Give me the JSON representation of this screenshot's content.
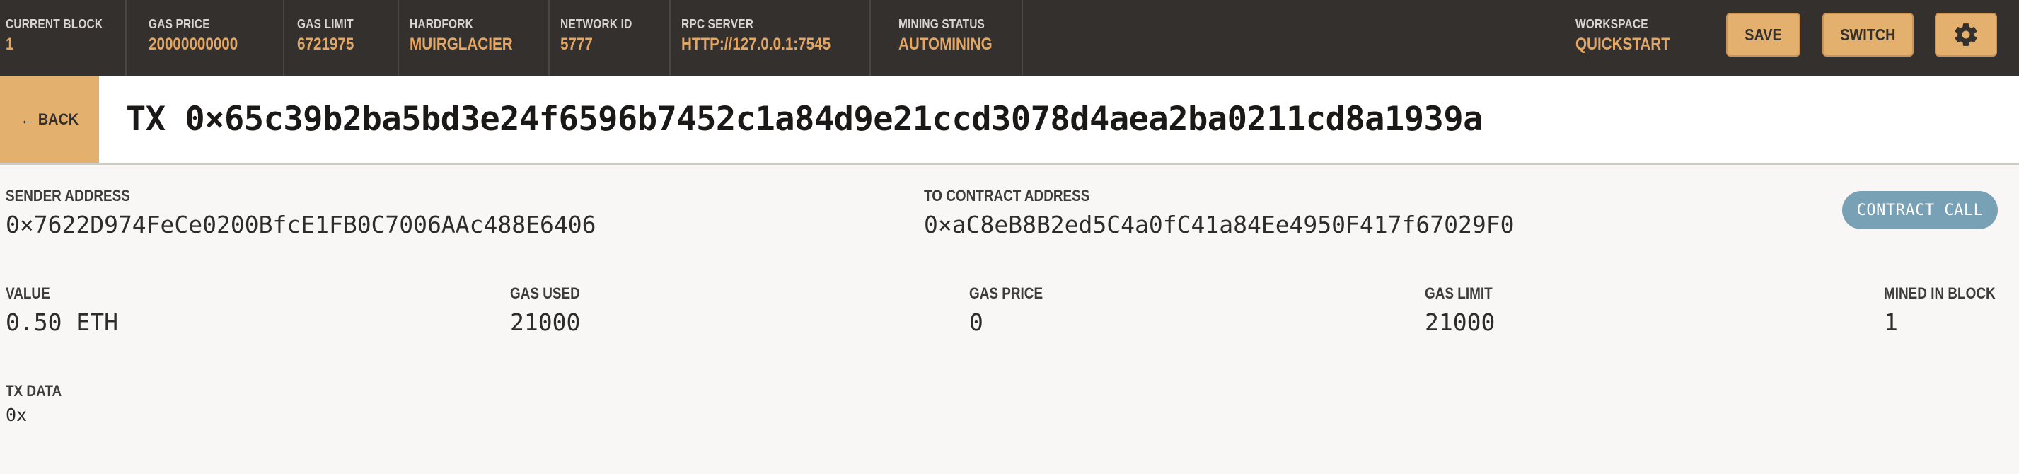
{
  "topbar": {
    "stats": [
      {
        "label": "CURRENT BLOCK",
        "value": "1"
      },
      {
        "label": "GAS PRICE",
        "value": "20000000000"
      },
      {
        "label": "GAS LIMIT",
        "value": "6721975"
      },
      {
        "label": "HARDFORK",
        "value": "MUIRGLACIER"
      },
      {
        "label": "NETWORK ID",
        "value": "5777"
      },
      {
        "label": "RPC SERVER",
        "value": "HTTP://127.0.0.1:7545"
      },
      {
        "label": "MINING STATUS",
        "value": "AUTOMINING"
      }
    ],
    "workspace": {
      "label": "WORKSPACE",
      "value": "QUICKSTART"
    },
    "save_label": "SAVE",
    "switch_label": "SWITCH",
    "settings_icon": "gear-icon"
  },
  "titlebar": {
    "back_label": "← BACK",
    "title": "TX 0×65c39b2ba5bd3e24f6596b7452c1a84d9e21ccd3078d4aea2ba0211cd8a1939a"
  },
  "tx": {
    "sender": {
      "label": "SENDER ADDRESS",
      "value": "0×7622D974FeCe0200BfcE1FB0C7006AAc488E6406"
    },
    "to": {
      "label": "TO CONTRACT ADDRESS",
      "value": "0×aC8eB8B2ed5C4a0fC41a84Ee4950F417f67029F0"
    },
    "badge": "CONTRACT CALL",
    "value": {
      "label": "VALUE",
      "value": "0.50 ETH"
    },
    "gas_used": {
      "label": "GAS USED",
      "value": "21000"
    },
    "gas_price": {
      "label": "GAS PRICE",
      "value": "0"
    },
    "gas_limit": {
      "label": "GAS LIMIT",
      "value": "21000"
    },
    "mined_in_block": {
      "label": "MINED IN BLOCK",
      "value": "1"
    },
    "data": {
      "label": "TX DATA",
      "value": "0x"
    }
  },
  "colors": {
    "topbar_bg": "#33302e",
    "accent": "#e4a663",
    "button_bg": "#e4b06e",
    "badge_bg": "#78a1b6",
    "page_bg": "#f8f7f5"
  }
}
